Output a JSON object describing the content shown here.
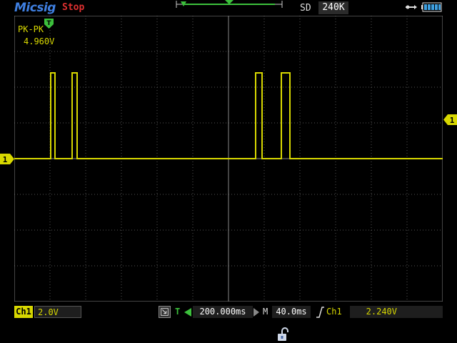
{
  "header": {
    "brand": "Micsig",
    "run_state": "Stop",
    "acq_mode": "SD",
    "mem_depth": "240K"
  },
  "measurement": {
    "label": "PK-PK",
    "value": "4.960V"
  },
  "channel": {
    "tag": "Ch1",
    "scale": "2.0V",
    "marker": "1"
  },
  "timebase": {
    "t_letter": "T",
    "position": "200.000ms",
    "m_letter": "M",
    "scale": "40.0ms"
  },
  "trigger": {
    "source": "Ch1",
    "level": "2.240V",
    "marker": "1"
  },
  "colors": {
    "ch1": "#d8d800",
    "trigger_green": "#3cc03c",
    "brand_blue": "#3f7fe0",
    "stop_red": "#e03030",
    "grid": "#555555"
  },
  "icons": [
    "usb-icon",
    "battery-icon",
    "trigger-t-icon",
    "zoom-icon",
    "arrow-left-icon",
    "arrow-right-icon",
    "rising-edge-icon",
    "lock-icon"
  ]
}
